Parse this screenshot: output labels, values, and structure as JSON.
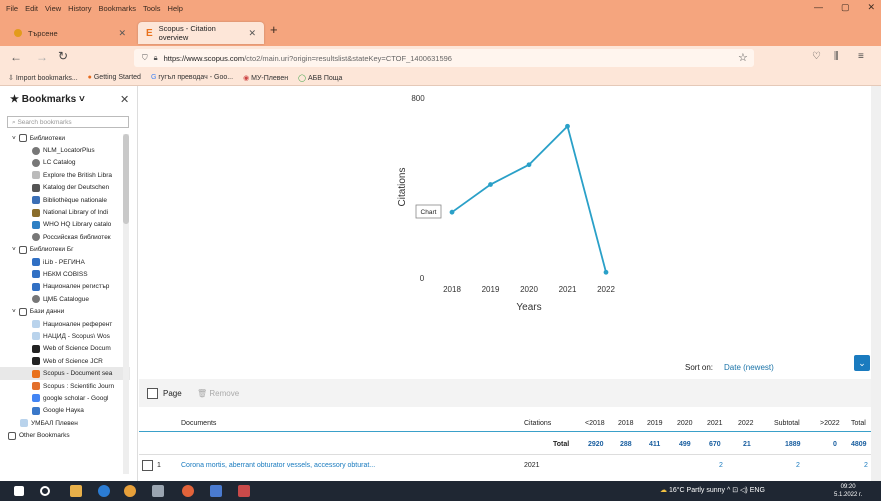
{
  "menu": [
    "File",
    "Edit",
    "View",
    "History",
    "Bookmarks",
    "Tools",
    "Help"
  ],
  "window_controls": [
    "—",
    "▢",
    "✕"
  ],
  "tabs": [
    {
      "title": "Търсене",
      "close": "✕"
    },
    {
      "title": "Scopus - Citation overview",
      "close": "✕"
    }
  ],
  "new_tab": "+",
  "url": {
    "host": "https://www.scopus.com",
    "path": "/cto2/main.uri?origin=resultslist&stateKey=CTOF_1400631596"
  },
  "bookmarks_toolbar": [
    "Import bookmarks...",
    "Getting Started",
    "гугъл преводач - Goo...",
    "МУ-Плевен",
    "АБВ Поща"
  ],
  "sidebar": {
    "title": "Bookmarks",
    "search_placeholder": "Search bookmarks",
    "items": [
      {
        "label": "Библиотеки",
        "type": "folder",
        "indent": 1
      },
      {
        "label": "NLM_LocatorPlus",
        "type": "globe",
        "indent": 2
      },
      {
        "label": "LC Catalog",
        "type": "globe",
        "indent": 2
      },
      {
        "label": "Explore the British Libra",
        "type": "line",
        "indent": 2
      },
      {
        "label": "Katalog der Deutschen",
        "type": "book",
        "indent": 2
      },
      {
        "label": "Bibliothèque nationale",
        "type": "bnf",
        "indent": 2
      },
      {
        "label": "National Library of Indi",
        "type": "emblem",
        "indent": 2
      },
      {
        "label": "WHO HQ Library catalo",
        "type": "k",
        "indent": 2
      },
      {
        "label": "Российская библиотек",
        "type": "globe",
        "indent": 2
      },
      {
        "label": "Библиотеки Бг",
        "type": "folder",
        "indent": 1
      },
      {
        "label": "iLib - РЕГИНА",
        "type": "blue",
        "indent": 2
      },
      {
        "label": "НБКМ COBISS",
        "type": "blue",
        "indent": 2
      },
      {
        "label": "Национален регистър",
        "type": "blue",
        "indent": 2
      },
      {
        "label": "ЦМБ Catalogue",
        "type": "globe",
        "indent": 2
      },
      {
        "label": "Бази данни",
        "type": "folder",
        "indent": 1
      },
      {
        "label": "Национален референт",
        "type": "light",
        "indent": 2
      },
      {
        "label": "НАЦИД - Scopus\\ Wos",
        "type": "light",
        "indent": 2
      },
      {
        "label": "Web of Science Docum",
        "type": "wos",
        "indent": 2
      },
      {
        "label": "Web of Science JCR",
        "type": "wos",
        "indent": 2
      },
      {
        "label": "Scopus - Document sea",
        "type": "scopus",
        "indent": 2
      },
      {
        "label": "Scopus : Scientific Journ",
        "type": "orange",
        "indent": 2
      },
      {
        "label": "google scholar - Googl",
        "type": "google",
        "indent": 2
      },
      {
        "label": "Google Наука",
        "type": "cap",
        "indent": 2
      },
      {
        "label": "УМБАЛ Плевен",
        "type": "light",
        "indent": 1
      },
      {
        "label": "Other Bookmarks",
        "type": "folder",
        "indent": 0
      }
    ]
  },
  "chart_data": {
    "type": "line",
    "x": [
      "2018",
      "2019",
      "2020",
      "2021",
      "2022"
    ],
    "values": [
      288,
      411,
      499,
      670,
      21
    ],
    "xlabel": "Years",
    "ylabel": "Citations",
    "yticks": [
      "800",
      "0"
    ],
    "ylim": [
      0,
      800
    ],
    "grid": false,
    "color": "#2aa0c8",
    "tooltip": "Chart"
  },
  "sort": {
    "label": "Sort on:",
    "value": "Date (newest)",
    "button_icon": "chevron-down-icon"
  },
  "toolbar": {
    "page": "Page",
    "remove": "Remove"
  },
  "table": {
    "headers": [
      "Documents",
      "Citations",
      "<2018",
      "2018",
      "2019",
      "2020",
      "2021",
      "2022",
      "Subtotal",
      ">2022",
      "Total"
    ],
    "totals": {
      "label": "Total",
      "values": [
        "2920",
        "288",
        "411",
        "499",
        "670",
        "21",
        "1889",
        "0",
        "4809"
      ]
    },
    "rows": [
      {
        "index": "1",
        "title": "Corona mortis, aberrant obturator vessels, accessory obturat...",
        "year": "2021",
        "y2021": "2",
        "subtotal": "2",
        "total": "2"
      }
    ]
  },
  "taskbar": {
    "weather": "16°C  Partly sunny",
    "lang": "ENG",
    "time": "09:20",
    "date": "5.1.2022 г."
  }
}
